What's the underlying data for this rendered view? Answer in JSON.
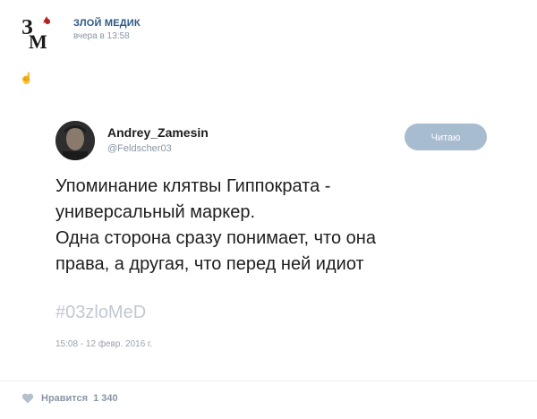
{
  "post": {
    "author": "ЗЛОЙ МЕДИК",
    "time": "вчера в 13:58",
    "emoji_icon": "hand-icon"
  },
  "tweet": {
    "name": "Andrey_Zamesin",
    "handle": "@Feldscher03",
    "follow_label": "Читаю",
    "lines": [
      "Упоминание клятвы Гиппократа -",
      "универсальный маркер.",
      "Одна сторона сразу понимает, что она",
      "права, а другая, что перед ней идиот"
    ],
    "hashtag": "#03zloMeD",
    "date": "15:08 - 12 февр. 2016 г."
  },
  "footer": {
    "like_label": "Нравится",
    "like_count": "1 340"
  },
  "colors": {
    "link": "#2a5885",
    "muted": "#8a96a6",
    "button": "#a8bcd0"
  }
}
